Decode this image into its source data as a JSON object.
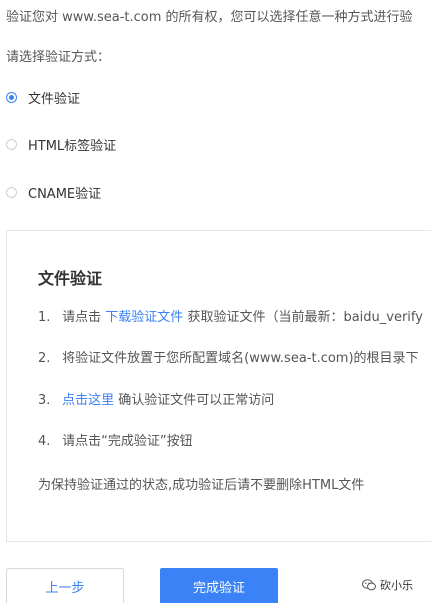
{
  "intro": "验证您对 www.sea-t.com 的所有权，您可以选择任意一种方式进行验",
  "prompt": "请选择验证方式：",
  "options": [
    {
      "label": "文件验证",
      "checked": true
    },
    {
      "label": "HTML标签验证",
      "checked": false
    },
    {
      "label": "CNAME验证",
      "checked": false
    }
  ],
  "panel": {
    "title": "文件验证",
    "step1": {
      "num": "1.",
      "prefix": "请点击",
      "link": "下载验证文件",
      "suffix": "获取验证文件（当前最新：baidu_verify"
    },
    "step2": {
      "num": "2.",
      "text": "将验证文件放置于您所配置域名(www.sea-t.com)的根目录下"
    },
    "step3": {
      "num": "3.",
      "link": "点击这里",
      "suffix": "确认验证文件可以正常访问"
    },
    "step4": {
      "num": "4.",
      "text": "请点击“完成验证”按钮"
    },
    "note": "为保持验证通过的状态,成功验证后请不要删除HTML文件"
  },
  "buttons": {
    "prev": "上一步",
    "done": "完成验证"
  },
  "watermark": "砍小乐",
  "colors": {
    "accent": "#3b82f6",
    "text": "#333333",
    "muted": "#555555",
    "border": "#e6e6e6"
  },
  "icons": {
    "watermark": "wechat-icon",
    "radio_checked": "radio-checked-icon",
    "radio_unchecked": "radio-unchecked-icon"
  }
}
